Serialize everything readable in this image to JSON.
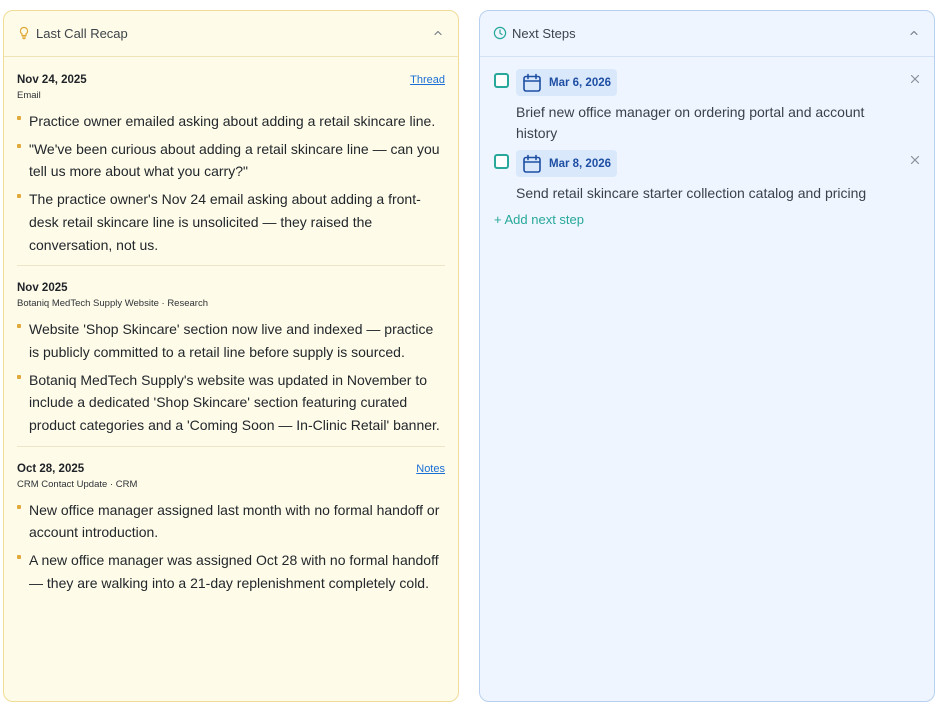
{
  "recap": {
    "title": "Last Call Recap",
    "accent_color": "#e0a93a",
    "header_icon": "lightbulb-icon",
    "entries": [
      {
        "date": "Nov 24, 2025",
        "source": "Email",
        "link": "Thread",
        "bullets": [
          "Practice owner emailed asking about adding a retail skincare line.",
          "\"We've been curious about adding a retail skincare line — can you tell us more about what you carry?\"",
          "The practice owner's Nov 24 email asking about adding a front-desk retail skincare line is unsolicited — they raised the conversation, not us."
        ]
      },
      {
        "date": "Nov 2025",
        "source": "Botaniq MedTech Supply Website · Research",
        "link": "",
        "bullets": [
          "Website 'Shop Skincare' section now live and indexed — practice is publicly committed to a retail line before supply is sourced.",
          "Botaniq MedTech Supply's website was updated in November to include a dedicated 'Shop Skincare' section featuring curated product categories and a 'Coming Soon — In-Clinic Retail' banner."
        ]
      },
      {
        "date": "Oct 28, 2025",
        "source": "CRM Contact Update · CRM",
        "link": "Notes",
        "bullets": [
          "New office manager assigned last month with no formal handoff or account introduction.",
          "A new office manager was assigned Oct 28 with no formal handoff — they are walking into a 21-day replenishment completely cold."
        ]
      }
    ]
  },
  "next_steps": {
    "title": "Next Steps",
    "accent_color": "#27a89a",
    "header_icon": "clock-icon",
    "items": [
      {
        "date": "Mar 6, 2026",
        "text": "Brief new office manager on ordering portal and account history",
        "checked": false
      },
      {
        "date": "Mar 8, 2026",
        "text": "Send retail skincare starter collection catalog and pricing",
        "checked": false
      }
    ],
    "add_label": "+ Add next step"
  }
}
